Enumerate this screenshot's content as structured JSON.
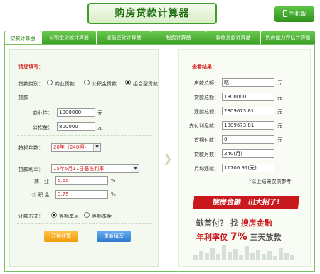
{
  "header": {
    "title": "购房贷款计算器",
    "mobile_label": "手机版"
  },
  "tabs": [
    "贷款计算器",
    "公积金贷款计算器",
    "提前还贷计算器",
    "税费计算器",
    "装修贷款计算器",
    "购房能力评估计算器"
  ],
  "form": {
    "section_title": "请您填写：",
    "loan_type_label": "贷款类别：",
    "loan_types": [
      "商业贷款",
      "公积金贷款",
      "组合型贷款"
    ],
    "loan_type_tail": "贷款",
    "commercial_label": "商业性：",
    "commercial_value": "1000000",
    "fund_label": "公积金：",
    "fund_value": "800000",
    "unit_yuan": "元",
    "term_label": "按揭年数：",
    "term_value": "20年（240期）",
    "rate_label": "贷款利率：",
    "rate_value": "15年5月11日基准利率",
    "biz_rate_label": "商　业",
    "biz_rate_value": "5.65",
    "fund_rate_label": "公 积 金",
    "fund_rate_value": "3.75",
    "percent": "%",
    "repay_label": "还款方式：",
    "repay_options": [
      "等额本息",
      "等额本金"
    ],
    "calc_button": "开始计算",
    "reset_button": "重新填写"
  },
  "results": {
    "section_title": "查看结果：",
    "rows": [
      {
        "label": "房款总额：",
        "value": "略",
        "unit": "元"
      },
      {
        "label": "贷款总额：",
        "value": "1800000",
        "unit": "元"
      },
      {
        "label": "还款总额：",
        "value": "2809673.81",
        "unit": "元"
      },
      {
        "label": "支付利息款：",
        "value": "1009673.81",
        "unit": "元"
      },
      {
        "label": "首期付款：",
        "value": "0",
        "unit": "元"
      },
      {
        "label": "贷款月数：",
        "value": "240(月)",
        "unit": ""
      },
      {
        "label": "月均还款：",
        "value": "11706.97(元)",
        "unit": ""
      }
    ],
    "note": "*以上结果仅供参考"
  },
  "ad": {
    "banner": "搜房金融　出大招了!",
    "line1_a": "缺首付？",
    "line1_b": "找",
    "line1_c": "搜房金融",
    "line2_a": "年利率仅",
    "line2_b": "7%",
    "line2_c": "三天放款"
  }
}
